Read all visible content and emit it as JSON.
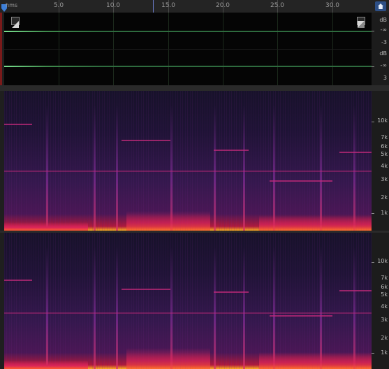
{
  "ruler": {
    "units_label": "hms",
    "ticks": [
      "5.0",
      "10.0",
      "15.0",
      "20.0",
      "25.0",
      "30.0"
    ]
  },
  "waveform": {
    "db_labels": [
      "dB",
      "-∞",
      "-3",
      "dB",
      "-∞",
      "3"
    ]
  },
  "spectrogram": {
    "freq_labels": [
      "10k",
      "7k",
      "6k",
      "5k",
      "4k",
      "3k",
      "2k",
      "1k"
    ]
  },
  "icons": {
    "home": "home-icon",
    "playhead": "playhead-marker-icon",
    "corner_left": "waveform-toggle-icon",
    "corner_right": "waveform-toggle-icon"
  },
  "colors": {
    "waveform_line": "#2e6b3e",
    "spectrogram_low": "#17122a",
    "spectrogram_high": "#ffb020",
    "accent": "#2d4f86"
  }
}
